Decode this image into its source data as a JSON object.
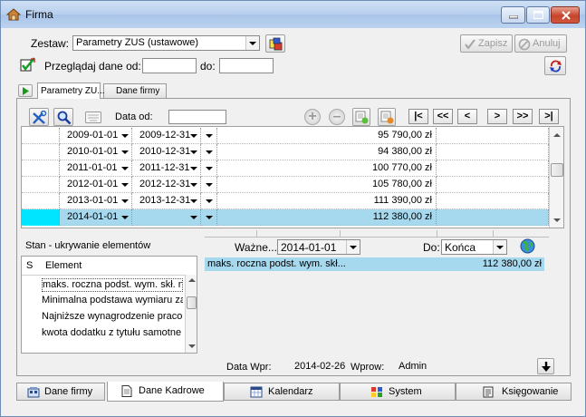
{
  "window": {
    "title": "Firma",
    "icons": [
      "app-house-icon",
      "minimize-icon",
      "maximize-icon",
      "close-icon"
    ]
  },
  "header": {
    "zestaw_label": "Zestaw:",
    "zestaw_value": "Parametry ZUS (ustawowe)",
    "save_label": "Zapisz",
    "cancel_label": "Anuluj",
    "browse_label": "Przeglądaj dane od:",
    "browse_from": "",
    "browse_to_label": "do:",
    "browse_to": ""
  },
  "tabs": [
    {
      "label": "Parametry ZU..."
    },
    {
      "label": "Dane firmy"
    }
  ],
  "toolbar": {
    "data_od_label": "Data od:",
    "data_od_value": "",
    "nav": [
      "|<",
      "<<",
      "<",
      ">",
      ">>",
      ">|"
    ]
  },
  "grid": {
    "rows": [
      {
        "from": "2009-01-01",
        "to": "2009-12-31",
        "amount": "95 790,00 zł"
      },
      {
        "from": "2010-01-01",
        "to": "2010-12-31",
        "amount": "94 380,00 zł"
      },
      {
        "from": "2011-01-01",
        "to": "2011-12-31",
        "amount": "100 770,00 zł"
      },
      {
        "from": "2012-01-01",
        "to": "2012-12-31",
        "amount": "105 780,00 zł"
      },
      {
        "from": "2013-01-01",
        "to": "2013-12-31",
        "amount": "111 390,00 zł"
      },
      {
        "from": "2014-01-01",
        "to": "",
        "amount": "112 380,00 zł"
      }
    ],
    "selected_index": 5,
    "selection_color": "#a6d8ee"
  },
  "left_panel": {
    "title": "Stan - ukrywanie elementów",
    "col_s": "S",
    "col_element": "Element",
    "items": [
      "maks. roczna podst. wym. skł. n",
      "Minimalna podstawa wymiaru za",
      "Najniższe wynagrodzenie pracou",
      "kwota dodatku z tytułu samotne"
    ]
  },
  "detail": {
    "wazne_label": "Ważne...",
    "wazne_value": "2014-01-01",
    "do_label": "Do:",
    "do_value": "Końca",
    "line_label": "maks. roczna podst. wym. skł...",
    "line_value": "112 380,00 zł"
  },
  "footer": {
    "data_wpr_label": "Data Wpr:",
    "data_wpr_value": "2014-02-26",
    "wprow_label": "Wprow:",
    "wprow_value": "Admin"
  },
  "bottom_tabs": [
    {
      "label": "Dane firmy",
      "icon": "company-icon"
    },
    {
      "label": "Dane Kadrowe",
      "icon": "document-icon"
    },
    {
      "label": "Kalendarz",
      "icon": "calendar-icon"
    },
    {
      "label": "System",
      "icon": "system-icon"
    },
    {
      "label": "Księgowanie",
      "icon": "ledger-icon"
    }
  ],
  "colors": {
    "accent": "#a6d8ee",
    "selected_row_marker": "#00e5ff"
  }
}
